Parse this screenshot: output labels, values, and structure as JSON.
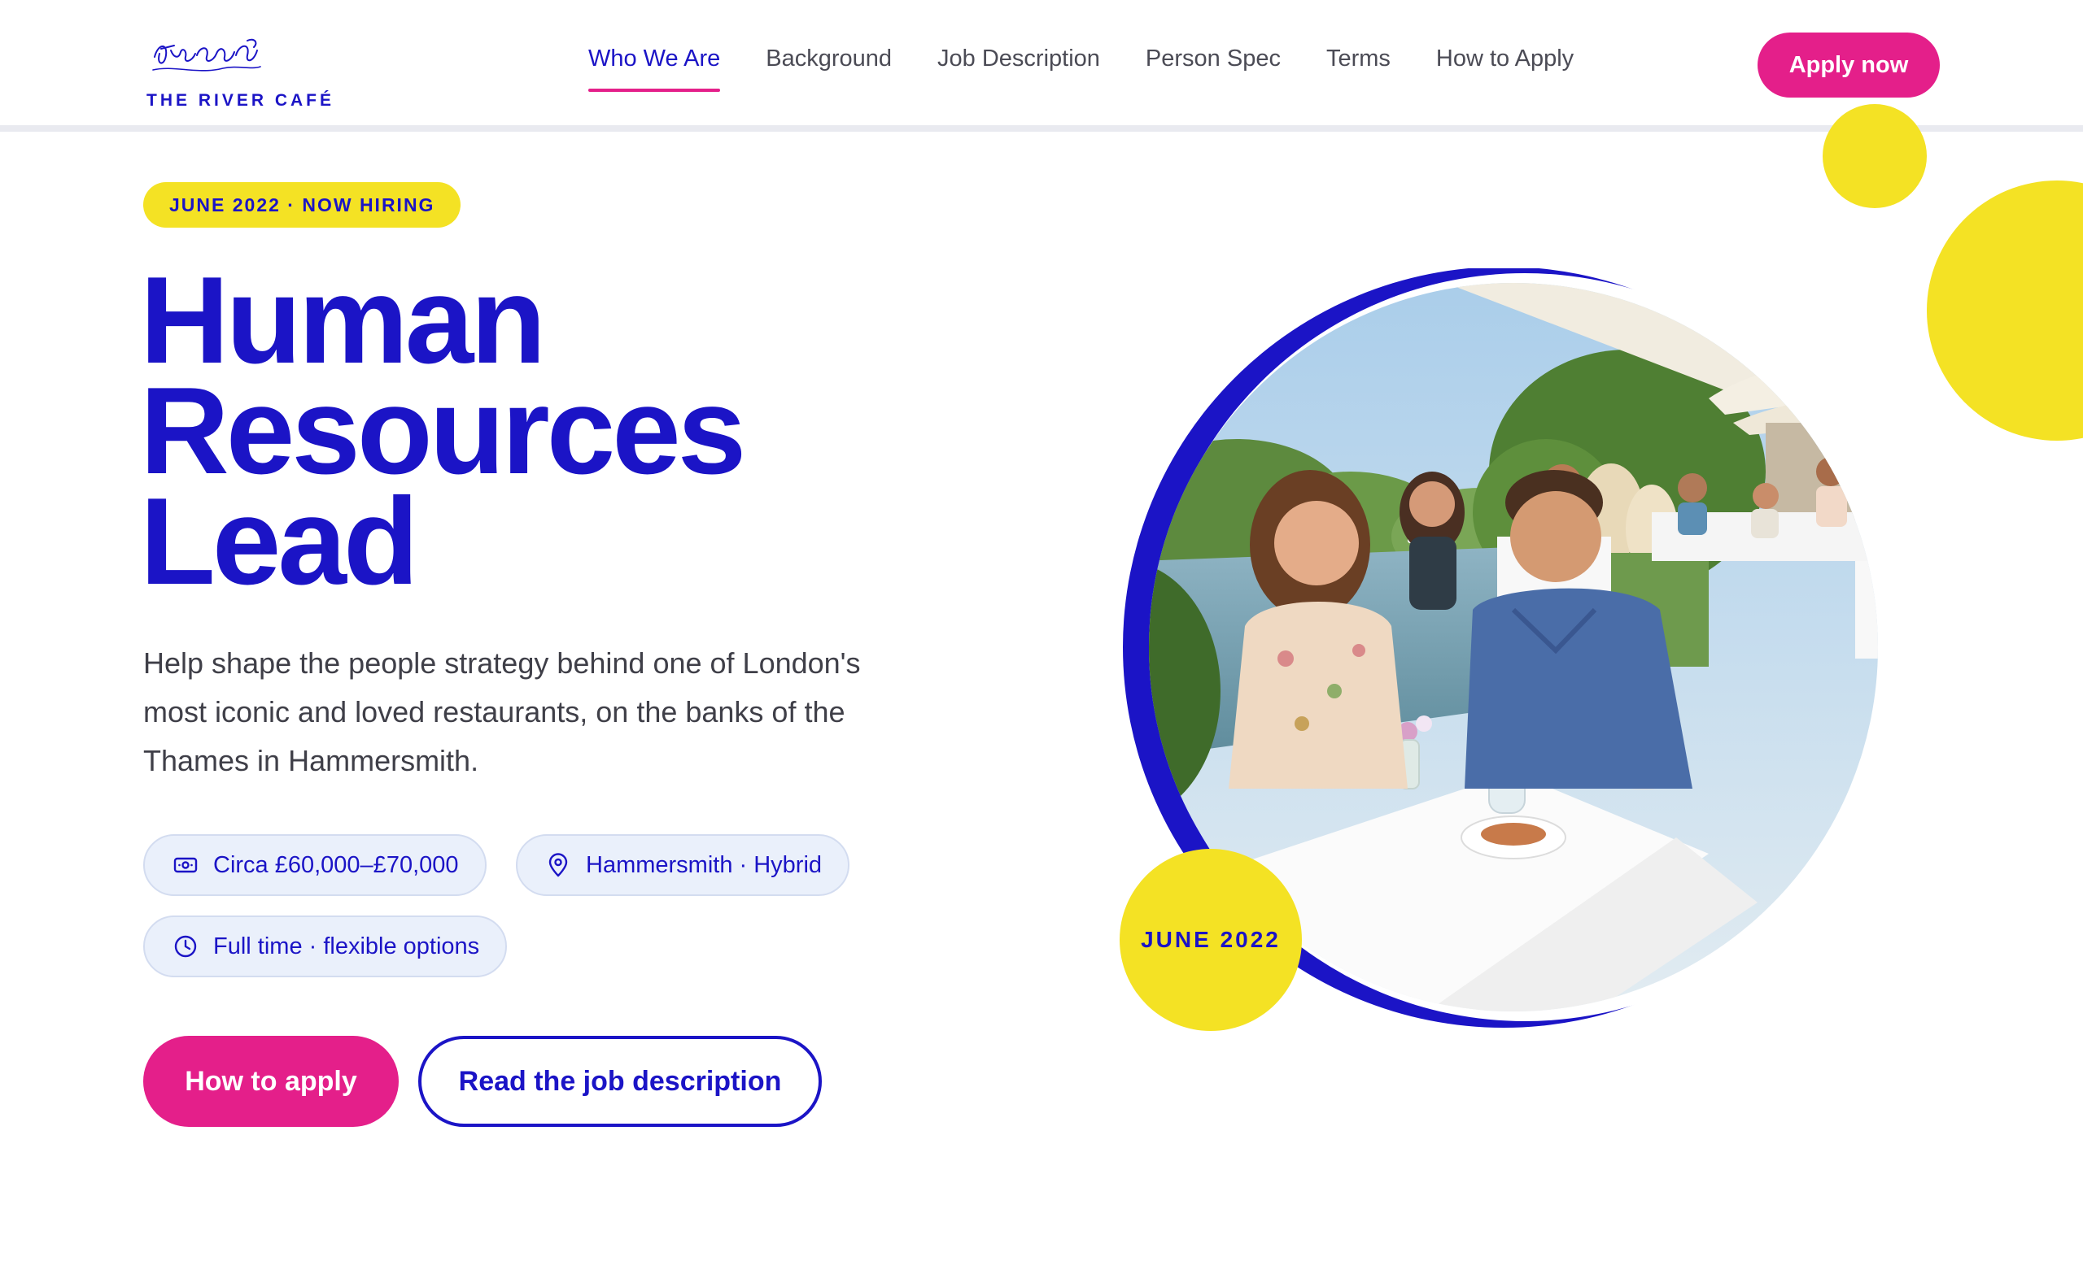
{
  "brand": {
    "name": "THE RIVER CAFÉ",
    "accent": "#1b14c6",
    "pink": "#e41f8a",
    "yellow": "#f4e224"
  },
  "nav": {
    "items": [
      {
        "label": "Who We Are",
        "active": true
      },
      {
        "label": "Background",
        "active": false
      },
      {
        "label": "Job Description",
        "active": false
      },
      {
        "label": "Person Spec",
        "active": false
      },
      {
        "label": "Terms",
        "active": false
      },
      {
        "label": "How to Apply",
        "active": false
      }
    ],
    "cta": "Apply now"
  },
  "hero": {
    "badge": "JUNE 2022 · NOW HIRING",
    "title_lines": [
      "Human",
      "Resources",
      "Lead"
    ],
    "lead": "Help shape the people strategy behind one of London's most iconic and loved restaurants, on the banks of the Thames in Hammersmith.",
    "chips": {
      "salary": {
        "icon": "banknote-icon",
        "label": "Circa £60,000–£70,000"
      },
      "location": {
        "icon": "map-pin-icon",
        "label": "Hammersmith · Hybrid"
      },
      "hours": {
        "icon": "clock-icon",
        "label": "Full time · flexible options"
      }
    },
    "primary_cta": "How to apply",
    "secondary_cta": "Read the job description",
    "image_date": "JUNE 2022"
  }
}
